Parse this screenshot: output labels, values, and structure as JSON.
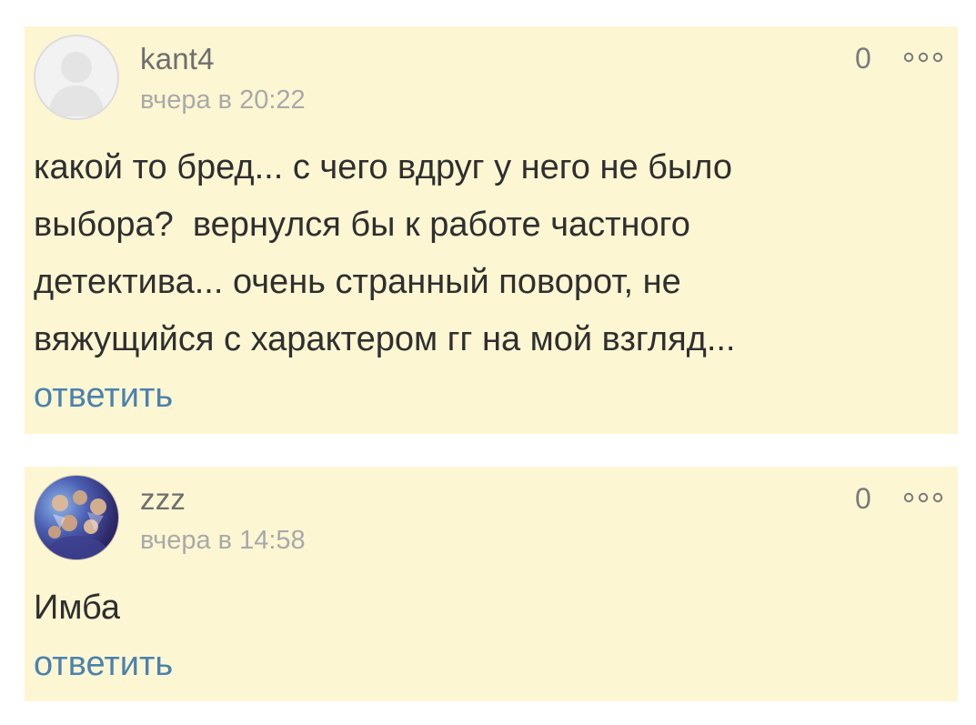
{
  "comments": [
    {
      "username": "kant4",
      "timestamp": "вчера в 20:22",
      "rating": "0",
      "text": "какой то бред... с чего вдруг у него не было\nвыбора?  вернулся бы к работе частного\nдетектива... очень странный поворот, не\nвяжущийся с характером гг на мой взгляд...",
      "reply_label": "ответить",
      "avatar_icon": "default-user-avatar"
    },
    {
      "username": "zzz",
      "timestamp": "вчера в 14:58",
      "rating": "0",
      "text": "Имба",
      "reply_label": "ответить",
      "avatar_icon": "user-photo-avatar"
    }
  ],
  "more_icon": "more-dots-icon",
  "colors": {
    "card_background": "#fdf6d3",
    "link": "#4a82ad",
    "username": "#6f6f6f",
    "timestamp": "#a9a9a9",
    "text": "#2f2f2f"
  }
}
